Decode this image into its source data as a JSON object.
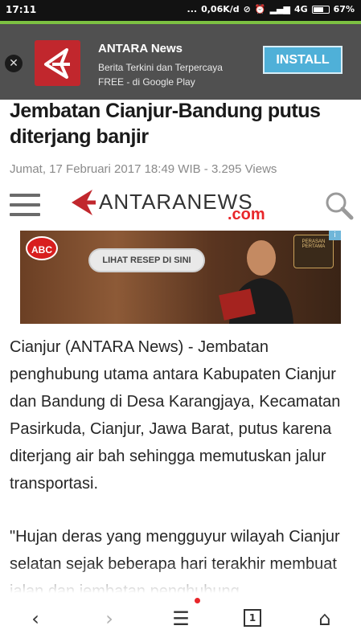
{
  "status_bar": {
    "time": "17:11",
    "dots": "...",
    "speed": "0,06K/d",
    "network": "4G",
    "battery": "67%"
  },
  "app_banner": {
    "app_name": "ANTARA News",
    "tagline_line1": "Berita Terkini dan Terpercaya",
    "tagline_line2": "FREE - di Google Play",
    "install_label": "INSTALL",
    "close_glyph": "✕"
  },
  "article": {
    "title": "Jembatan Cianjur-Bandung putus diterjang banjir",
    "meta": "Jumat, 17 Februari 2017 18:49 WIB - 3.295 Views",
    "paragraphs": [
      "Cianjur (ANTARA News) - Jembatan penghubung utama antara Kabupaten Cianjur dan Bandung di Desa Karangjaya, Kecamatan Pasirkuda, Cianjur, Jawa Barat, putus karena diterjang air bah sehingga memutuskan jalur transportasi.",
      "\"Hujan deras yang mengguyur wilayah Cianjur selatan sejak beberapa hari terakhir membuat jalan dan jembatan penghubung"
    ]
  },
  "site_header": {
    "logo_text": "ANTARANEWS",
    "logo_suffix": ".com"
  },
  "ad": {
    "brand": "ABC",
    "cta": "LIHAT RESEP DI SINI",
    "badge": "PERASAN PERTAMA",
    "info": "i"
  },
  "bottom_nav": {
    "back": "‹",
    "forward": "›",
    "menu": "☰",
    "tabs_count": "1",
    "home": "⌂"
  },
  "colors": {
    "accent_green": "#7cc142",
    "brand_red": "#c1272d",
    "install_blue": "#4fb0d8"
  }
}
